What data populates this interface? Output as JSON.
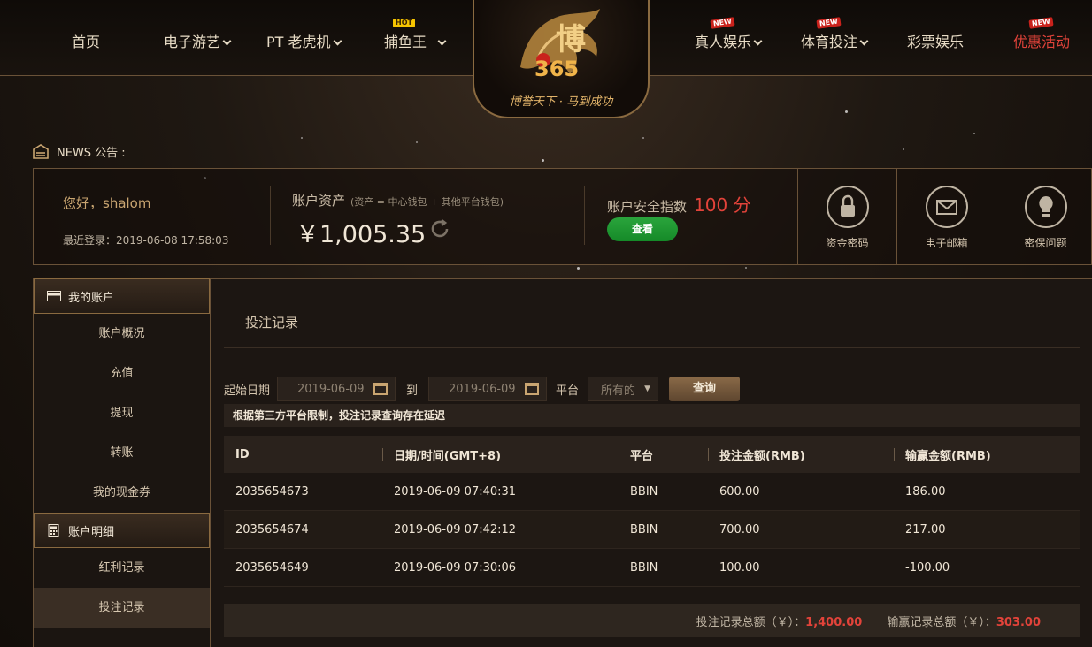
{
  "nav": {
    "items": [
      {
        "label": "首页",
        "has_dropdown": false
      },
      {
        "label": "电子游艺",
        "has_dropdown": true
      },
      {
        "label": "PT 老虎机",
        "has_dropdown": true
      },
      {
        "label": "捕鱼王",
        "has_dropdown": true,
        "badge": "HOT"
      },
      {
        "label": "真人娱乐",
        "has_dropdown": true,
        "badge": "NEW"
      },
      {
        "label": "体育投注",
        "has_dropdown": true,
        "badge": "NEW"
      },
      {
        "label": "彩票娱乐",
        "has_dropdown": false
      },
      {
        "label": "优惠活动",
        "has_dropdown": false,
        "badge": "NEW",
        "highlight": true
      }
    ]
  },
  "logo": {
    "text_main": "博",
    "text_num": "365",
    "slogan": "博誉天下 · 马到成功"
  },
  "news": {
    "label": "NEWS 公告 :"
  },
  "account": {
    "greeting": "您好，shalom",
    "last_login": "最近登录：2019-06-08 17:58:03",
    "assets_label": "账户资产",
    "assets_note": "(资产 = 中心钱包 + 其他平台钱包)",
    "assets_value": "￥1,005.35",
    "security_label": "账户安全指数",
    "security_score": "100 分",
    "security_button": "查看",
    "tiles": [
      {
        "label": "资金密码",
        "icon": "lock-icon"
      },
      {
        "label": "电子邮箱",
        "icon": "mail-icon"
      },
      {
        "label": "密保问题",
        "icon": "bulb-icon"
      }
    ]
  },
  "sidebar": {
    "section1": {
      "title": "我的账户",
      "icon": "card-icon"
    },
    "items1": [
      "账户概况",
      "充值",
      "提现",
      "转账",
      "我的现金券"
    ],
    "section2": {
      "title": "账户明细",
      "icon": "calculator-icon"
    },
    "items2": [
      "红利记录",
      "投注记录"
    ],
    "active": "投注记录"
  },
  "main": {
    "title": "投注记录",
    "filter": {
      "start_label": "起始日期",
      "start_date": "2019-06-09",
      "to_label": "到",
      "end_date": "2019-06-09",
      "platform_label": "平台",
      "platform_value": "所有的",
      "query_button": "查询"
    },
    "notice": "根据第三方平台限制，投注记录查询存在延迟",
    "table": {
      "headers": [
        "ID",
        "日期/时间(GMT+8)",
        "平台",
        "投注金额(RMB)",
        "输赢金额(RMB)"
      ],
      "rows": [
        [
          "2035654673",
          "2019-06-09 07:40:31",
          "BBIN",
          "600.00",
          "186.00"
        ],
        [
          "2035654674",
          "2019-06-09 07:42:12",
          "BBIN",
          "700.00",
          "217.00"
        ],
        [
          "2035654649",
          "2019-06-09 07:30:06",
          "BBIN",
          "100.00",
          "-100.00"
        ]
      ]
    },
    "totals": {
      "bet_label": "投注记录总额（￥）：",
      "bet_value": "1,400.00",
      "win_label": "输赢记录总额（￥）：",
      "win_value": "303.00"
    }
  },
  "colors": {
    "accent_gold": "#c9a571",
    "alert_red": "#e2433a",
    "success_green": "#1f9a33"
  }
}
